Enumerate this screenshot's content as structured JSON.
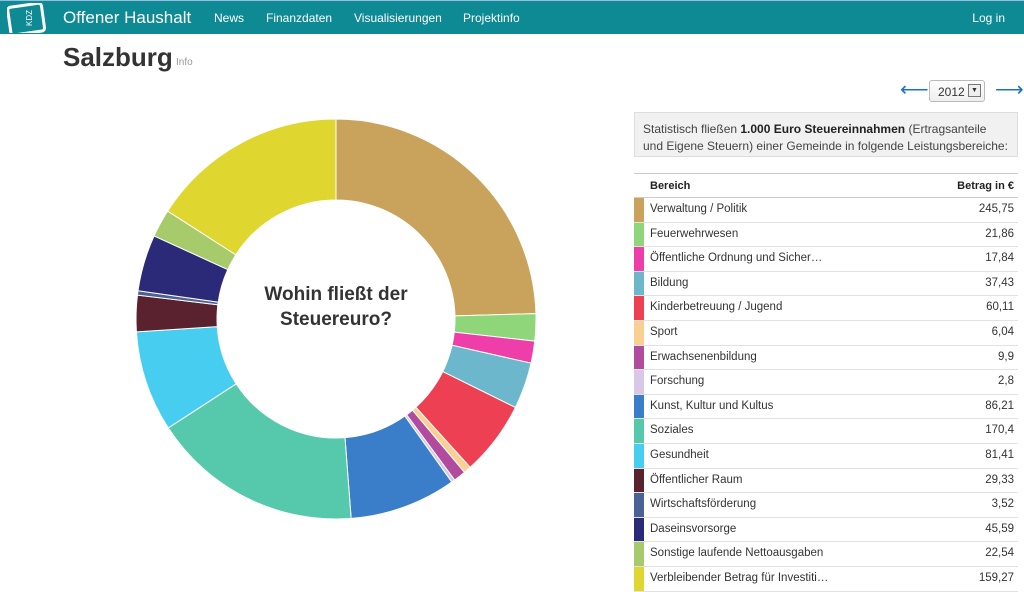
{
  "nav": {
    "brand": "Offener Haushalt",
    "logo_text": "KDZ",
    "items": [
      "News",
      "Finanzdaten",
      "Visualisierungen",
      "Projektinfo"
    ],
    "login": "Log in"
  },
  "page": {
    "title": "Salzburg",
    "info": "Info"
  },
  "year_nav": {
    "prev_arrow": "⟵",
    "next_arrow": "⟶",
    "year": "2012"
  },
  "info_box": {
    "pre": "Statistisch fließen ",
    "bold": "1.000 Euro Steuereinnahmen",
    "post": " (Ertragsanteile und Eigene Steuern) einer Gemeinde in folgende Leistungsbereiche:"
  },
  "table": {
    "col_area": "Bereich",
    "col_amount": "Betrag in €"
  },
  "chart_data": {
    "type": "pie",
    "donut": true,
    "center_label": [
      "Wohin fließt der",
      "Steuereuro?"
    ],
    "categories": [
      "Verwaltung / Politik",
      "Feuerwehrwesen",
      "Öffentliche Ordnung und Sicher…",
      "Bildung",
      "Kinderbetreuung / Jugend",
      "Sport",
      "Erwachsenenbildung",
      "Forschung",
      "Kunst, Kultur und Kultus",
      "Soziales",
      "Gesundheit",
      "Öffentlicher Raum",
      "Wirtschaftsförderung",
      "Daseinsvorsorge",
      "Sonstige laufende Nettoausgaben",
      "Verbleibender Betrag für Investiti…"
    ],
    "values": [
      245.75,
      21.86,
      17.84,
      37.43,
      60.11,
      6.04,
      9.9,
      2.8,
      86.21,
      170.4,
      81.41,
      29.33,
      3.52,
      45.59,
      22.54,
      159.27
    ],
    "value_labels": [
      "245,75",
      "21,86",
      "17,84",
      "37,43",
      "60,11",
      "6,04",
      "9,9",
      "2,8",
      "86,21",
      "170,4",
      "81,41",
      "29,33",
      "3,52",
      "45,59",
      "22,54",
      "159,27"
    ],
    "colors": [
      "#c9a35c",
      "#8fd67a",
      "#ee3eaa",
      "#6cb7cc",
      "#ee4053",
      "#f9cf92",
      "#b04b9e",
      "#d8c8e6",
      "#3a7dc8",
      "#56c9ad",
      "#46cdf0",
      "#5a222e",
      "#4a6394",
      "#2a2a78",
      "#a7cb6a",
      "#dfd630"
    ]
  }
}
